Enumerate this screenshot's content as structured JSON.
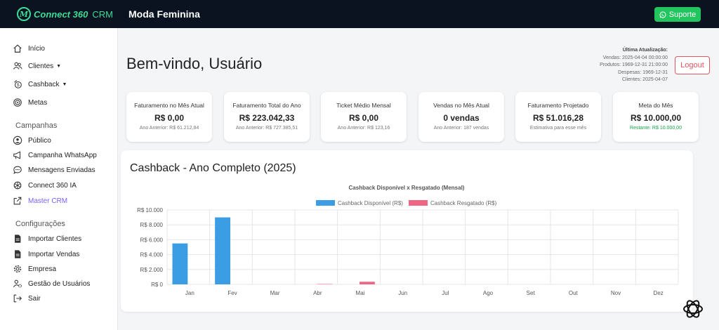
{
  "brand": {
    "logo_mark": "M",
    "name": "Connect 360",
    "suffix": "CRM"
  },
  "header": {
    "store_name": "Moda Feminina",
    "support_label": "Suporte",
    "support_icon": "whatsapp-icon"
  },
  "sidebar": {
    "items": [
      {
        "label": "Início",
        "icon": "home-icon"
      },
      {
        "label": "Clientes",
        "icon": "users-icon",
        "caret": "▼"
      },
      {
        "label": "Cashback",
        "icon": "cashback-icon",
        "caret": "▼"
      },
      {
        "label": "Metas",
        "icon": "target-icon"
      }
    ],
    "section_campanhas": "Campanhas",
    "campanhas": [
      {
        "label": "Público",
        "icon": "person-icon"
      },
      {
        "label": "Campanha WhatsApp",
        "icon": "megaphone-icon"
      },
      {
        "label": "Mensagens Enviadas",
        "icon": "chat-icon"
      },
      {
        "label": "Connect 360 IA",
        "icon": "ai-icon"
      },
      {
        "label": "Master CRM",
        "icon": "external-link-icon"
      }
    ],
    "section_config": "Configurações",
    "config": [
      {
        "label": "Importar Clientes",
        "icon": "file-icon"
      },
      {
        "label": "Importar Vendas",
        "icon": "file-icon"
      },
      {
        "label": "Empresa",
        "icon": "gear-icon"
      },
      {
        "label": "Gestão de Usuários",
        "icon": "users-gear-icon"
      },
      {
        "label": "Sair",
        "icon": "logout-icon"
      }
    ]
  },
  "main": {
    "welcome": "Bem-vindo, Usuário",
    "logout_label": "Logout",
    "update": {
      "title": "Última Atualização:",
      "vendas": "Vendas: 2025-04-04 00:00:00",
      "produtos": "Produtos: 1969-12-31 21:00:00",
      "despesas": "Despesas: 1969-12-31",
      "clientes": "Clientes: 2025-04-07"
    },
    "cards": [
      {
        "title": "Faturamento no Mês Atual",
        "value": "R$ 0,00",
        "sub": "Ano Anterior: R$ 61.212,84"
      },
      {
        "title": "Faturamento Total do Ano",
        "value": "R$ 223.042,33",
        "sub": "Ano Anterior: R$ 727.385,51"
      },
      {
        "title": "Ticket Médio Mensal",
        "value": "R$ 0,00",
        "sub": "Ano Anterior: R$ 123,16"
      },
      {
        "title": "Vendas no Mês Atual",
        "value": "0 vendas",
        "sub": "Ano Anterior: 187 vendas"
      },
      {
        "title": "Faturamento Projetado",
        "value": "R$ 51.016,28",
        "sub": "Estimativa para esse mês"
      },
      {
        "title": "Meta do Mês",
        "value": "R$ 10.000,00",
        "sub": "Restante: R$ 10.000,00"
      }
    ],
    "chart_heading": "Cashback - Ano Completo (2025)"
  },
  "colors": {
    "accent_green": "#3ddc97",
    "support_green": "#22c55e",
    "logout_red": "#e25563",
    "series_blue": "#3b9de3",
    "series_pink": "#f06583",
    "active_purple": "#7b61ff"
  },
  "chart_data": {
    "type": "bar",
    "title": "Cashback Disponível x Resgatado (Mensal)",
    "categories": [
      "Jan",
      "Fev",
      "Mar",
      "Abr",
      "Mai",
      "Jun",
      "Jul",
      "Ago",
      "Set",
      "Out",
      "Nov",
      "Dez"
    ],
    "series": [
      {
        "name": "Cashback Disponível (R$)",
        "color": "#3b9de3",
        "values": [
          5500,
          9000,
          0,
          0,
          0,
          0,
          0,
          0,
          0,
          0,
          0,
          0
        ]
      },
      {
        "name": "Cashback Resgatado (R$)",
        "color": "#f06583",
        "values": [
          0,
          0,
          0,
          50,
          350,
          0,
          0,
          0,
          0,
          0,
          0,
          0
        ]
      }
    ],
    "ylim": [
      0,
      10000
    ],
    "yticks": [
      0,
      2000,
      4000,
      6000,
      8000,
      10000
    ],
    "ytick_labels": [
      "R$ 0",
      "R$ 2.000",
      "R$ 4.000",
      "R$ 6.000",
      "R$ 8.000",
      "R$ 10.000"
    ],
    "legend": "top",
    "grid": true
  }
}
